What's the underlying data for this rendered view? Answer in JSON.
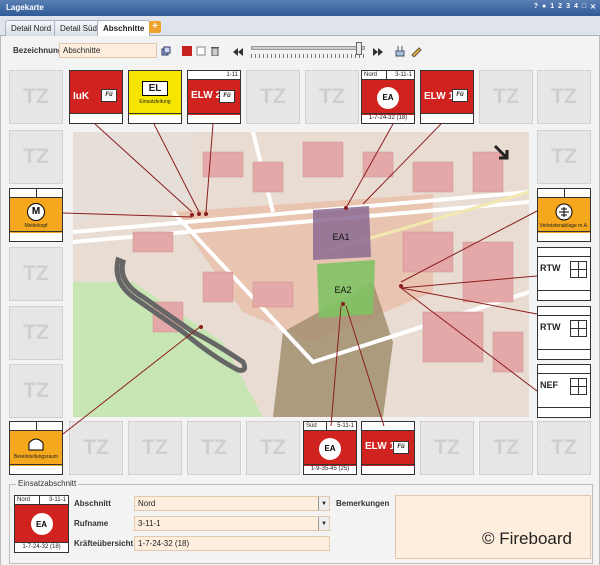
{
  "window": {
    "title": "Lagekarte",
    "controls": [
      "?",
      "●",
      "1",
      "2",
      "3",
      "4",
      "□",
      "✕"
    ]
  },
  "tabs": [
    {
      "label": "Detail Nord",
      "active": false
    },
    {
      "label": "Detail Süd",
      "active": false
    },
    {
      "label": "Abschnitte",
      "active": true
    }
  ],
  "toolbar": {
    "bezeichnung_label": "Bezeichnung",
    "bezeichnung_value": "Abschnitte",
    "slider_level": 0.95
  },
  "slot_label": "TZ",
  "units": {
    "iuk": {
      "name": "IuK",
      "fu": "Fü"
    },
    "el": {
      "name": "EL",
      "sub": "Einsatzleitung"
    },
    "elw2": {
      "name": "ELW 2",
      "id": "1-11",
      "fu": "Fü"
    },
    "ea_nord": {
      "top_left": "Nord",
      "top_right": "3-11-1",
      "name": "EA",
      "bottom": "1-7-24-32 (18)"
    },
    "elw1_top": {
      "name": "ELW 1",
      "fu": "Fü"
    },
    "meldekopf": {
      "symbol": "M",
      "sub": "Meldekopf"
    },
    "verletzte": {
      "sub": "Verletztenablage m.A."
    },
    "rtw1": {
      "name": "RTW"
    },
    "rtw2": {
      "name": "RTW"
    },
    "nef": {
      "name": "NEF"
    },
    "bereitstellung": {
      "sub": "Bereitstellungsraum"
    },
    "ea_sued": {
      "top_left": "Süd",
      "top_right": "5-11-1",
      "name": "EA",
      "bottom": "1-9-35-45 (25)"
    },
    "elw1_bottom": {
      "name": "ELW 1",
      "fu": "Fü"
    }
  },
  "map": {
    "areas": [
      "EA1",
      "EA2"
    ]
  },
  "section": {
    "title": "Einsatzabschnitt",
    "card": {
      "top_left": "Nord",
      "top_right": "3-11-1",
      "name": "EA",
      "bottom": "1-7-24-32 (18)"
    },
    "fields": [
      {
        "label": "Abschnitt",
        "value": "Nord"
      },
      {
        "label": "Rufname",
        "value": "3-11-1"
      },
      {
        "label": "Kräfteübersicht",
        "value": "1-7-24-32 (18)"
      }
    ],
    "remarks_label": "Bemerkungen",
    "remarks_value": ""
  },
  "copyright": "© Fireboard",
  "colors": {
    "unit_red": "#d0221f",
    "unit_yellow": "#f6e500",
    "unit_orange": "#f5a81d",
    "input_bg": "#fdeede",
    "title_blue": "#2f5a98"
  }
}
